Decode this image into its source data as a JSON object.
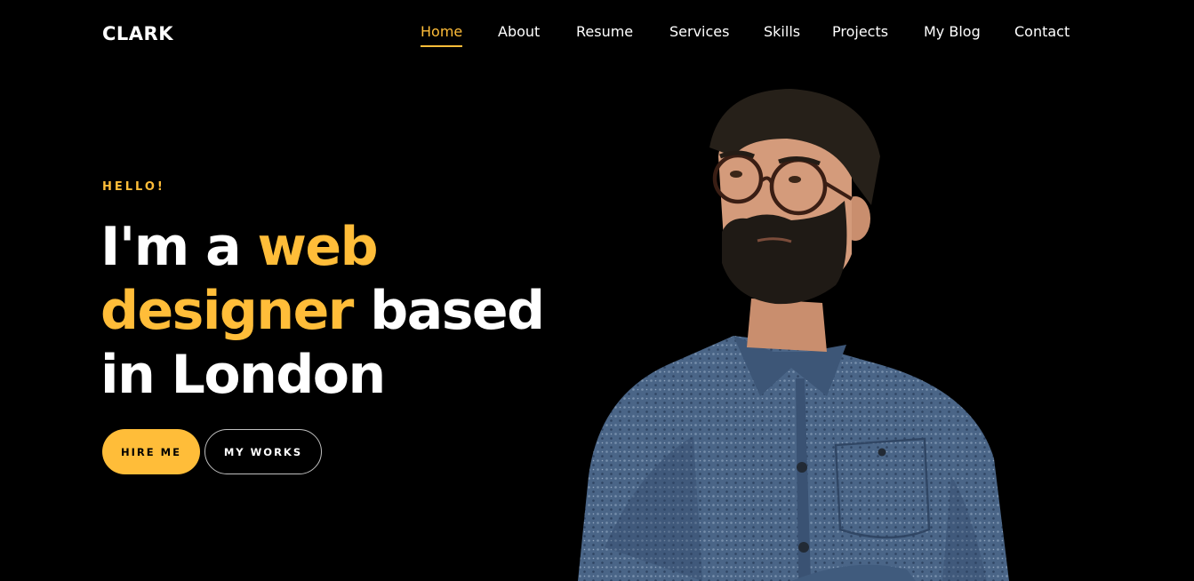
{
  "brand": {
    "logo": "CLARK"
  },
  "nav": {
    "items": [
      {
        "label": "Home",
        "active": true
      },
      {
        "label": "About",
        "active": false
      },
      {
        "label": "Resume",
        "active": false
      },
      {
        "label": "Services",
        "active": false
      },
      {
        "label": "Skills",
        "active": false
      },
      {
        "label": "Projects",
        "active": false
      },
      {
        "label": "My Blog",
        "active": false
      },
      {
        "label": "Contact",
        "active": false
      }
    ]
  },
  "hero": {
    "greeting": "HELLO!",
    "headline": {
      "part1": "I'm a ",
      "accent": "web designer",
      "part2": " based in London"
    },
    "buttons": {
      "primary": "HIRE ME",
      "secondary": "MY WORKS"
    },
    "image_description_icon": "man-with-glasses-portrait"
  },
  "colors": {
    "accent": "#ffbd39",
    "background": "#000000",
    "text": "#ffffff",
    "shirt": "#4a6587"
  }
}
